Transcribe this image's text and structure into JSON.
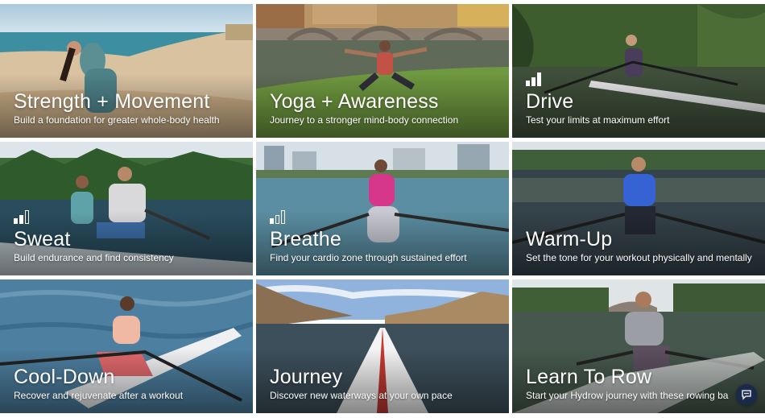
{
  "tiles": [
    {
      "title": "Strength + Movement",
      "subtitle": "Build a foundation for greater whole-body health",
      "level_icon": false
    },
    {
      "title": "Yoga + Awareness",
      "subtitle": "Journey to a stronger mind-body connection",
      "level_icon": false
    },
    {
      "title": "Drive",
      "subtitle": "Test your limits at maximum effort",
      "level_icon": true,
      "level": 3
    },
    {
      "title": "Sweat",
      "subtitle": "Build endurance and find consistency",
      "level_icon": true,
      "level": 2
    },
    {
      "title": "Breathe",
      "subtitle": "Find your cardio zone through sustained effort",
      "level_icon": true,
      "level": 1
    },
    {
      "title": "Warm-Up",
      "subtitle": "Set the tone for your workout physically and mentally",
      "level_icon": false
    },
    {
      "title": "Cool-Down",
      "subtitle": "Recover and rejuvenate after a workout",
      "level_icon": false
    },
    {
      "title": "Journey",
      "subtitle": "Discover new waterways at your own pace",
      "level_icon": false
    },
    {
      "title": "Learn To Row",
      "subtitle": "Start your Hydrow journey with these rowing ba",
      "level_icon": false
    }
  ],
  "chat_widget": {
    "icon": "chat-bubble-icon"
  }
}
